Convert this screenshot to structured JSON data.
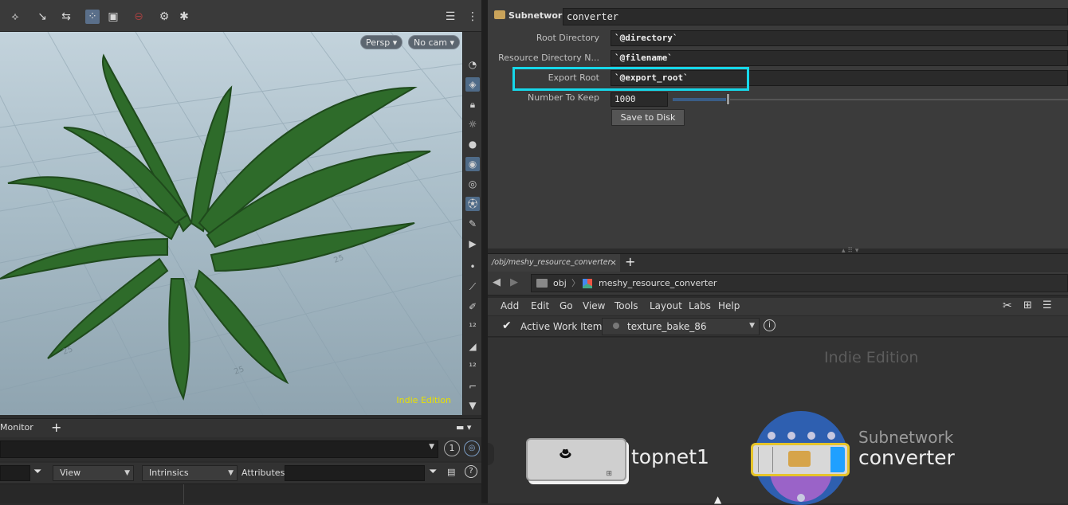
{
  "viewport": {
    "camera_menu": "Persp",
    "cam_menu": "No cam",
    "watermark": "Indie Edition"
  },
  "geometry_pane": {
    "tab_label": "Monitor",
    "add_tab": "+",
    "view_menu": "View",
    "intrinsics_menu": "Intrinsics",
    "attributes_label": "Attributes:",
    "counter": "1"
  },
  "params": {
    "node_type": "Subnetwork",
    "node_name": "converter",
    "rows": [
      {
        "label": "Root Directory",
        "value": "`@directory`"
      },
      {
        "label": "Resource Directory N...",
        "value": "`@filename`"
      },
      {
        "label": "Export Root",
        "value": "`@export_root`"
      }
    ],
    "number_to_keep_label": "Number To Keep",
    "number_to_keep_value": "1000",
    "number_to_keep_fraction": 0.14,
    "save_button": "Save to Disk"
  },
  "network": {
    "tab_label": "/obj/meshy_resource_converter",
    "tab_close": "×",
    "add_tab": "+",
    "path": [
      "obj",
      "meshy_resource_converter"
    ],
    "menu": [
      "Add",
      "Edit",
      "Go",
      "View",
      "Tools",
      "Layout",
      "Labs",
      "Help"
    ],
    "active_work_item_label": "Active Work Item:",
    "active_work_item_value": "texture_bake_86",
    "watermark": "Indie Edition",
    "nodes": {
      "topnet": {
        "label": "topnet1"
      },
      "subnet": {
        "type": "Subnetwork",
        "label": "converter"
      }
    }
  },
  "colors": {
    "highlight": "#16d8ea",
    "indie_viewport": "#e8e000",
    "node_selected_outline": "#e6c42a",
    "subnet_ring": "#2e5fb0"
  }
}
